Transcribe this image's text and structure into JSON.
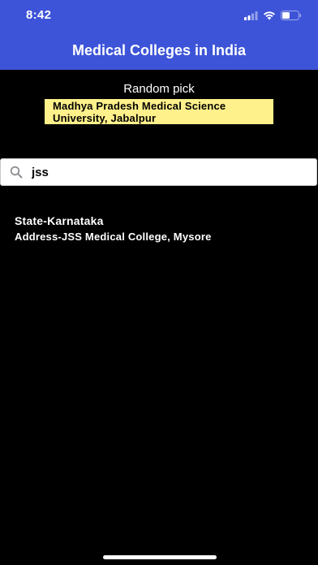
{
  "status_bar": {
    "time": "8:42",
    "icons": [
      "cellular-signal-icon",
      "wifi-icon",
      "battery-icon"
    ]
  },
  "header": {
    "title": "Medical Colleges in India",
    "background": "#3d54d8"
  },
  "random": {
    "label": "Random pick",
    "line1": "Madhya Pradesh Medical Science",
    "line2": "University, Jabalpur",
    "highlight": "#fef08a"
  },
  "search": {
    "value": "jss",
    "icon": "search-icon"
  },
  "results": [
    {
      "state": "State-Karnataka",
      "address": "Address-JSS Medical College, Mysore"
    }
  ]
}
